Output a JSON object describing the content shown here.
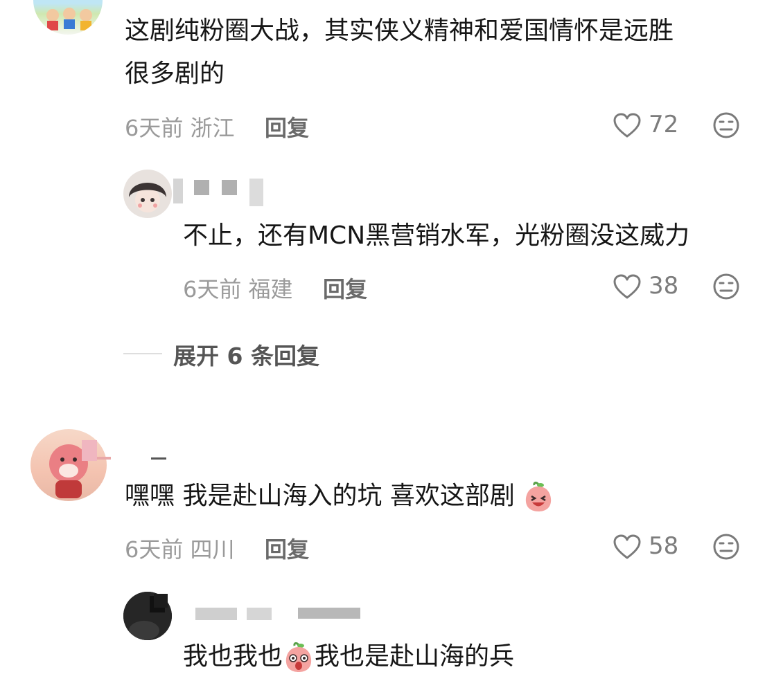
{
  "comments": [
    {
      "text_line1": "这剧纯粉圈大战，其实侠义精神和爱国情怀是远胜",
      "text_line2": "很多剧的",
      "meta": "6天前 浙江",
      "reply_label": "回复",
      "likes": "72",
      "avatar_icon": "cartoon-kids-avatar"
    },
    {
      "text": "不止，还有MCN黑营销水军，光粉圈没这威力",
      "meta": "6天前 福建",
      "reply_label": "回复",
      "likes": "38",
      "avatar_icon": "anime-girl-avatar"
    },
    {
      "expand_label": "展开 6 条回复"
    },
    {
      "text": "嘿嘿 我是赴山海入的坑 喜欢这部剧",
      "meta": "6天前 四川",
      "reply_label": "回复",
      "likes": "58",
      "avatar_icon": "pink-cartoon-avatar"
    },
    {
      "text_a": "我也我也",
      "text_b": "我也是赴山海的兵",
      "avatar_icon": "dark-photo-avatar"
    }
  ],
  "icons": {
    "heart": "heart-outline-icon",
    "dislike": "meh-face-icon",
    "laugh_emoji": "peach-laugh-emoji",
    "surprised_emoji": "peach-surprised-emoji"
  },
  "colors": {
    "text": "#161616",
    "meta": "#9a9a9a",
    "icon": "#7a7a7a"
  }
}
